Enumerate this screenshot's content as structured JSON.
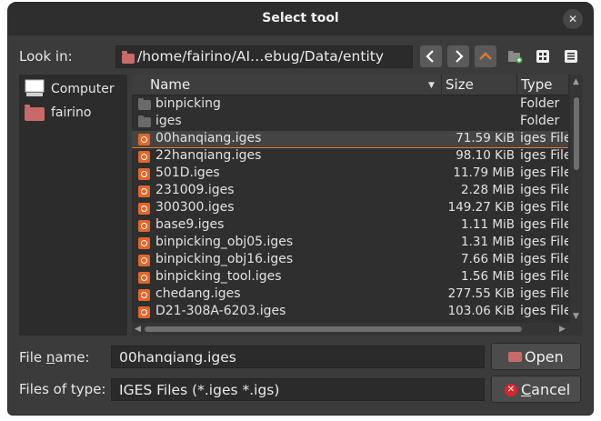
{
  "window": {
    "title": "Select tool"
  },
  "toolbar": {
    "look_in_label": "Look in:",
    "path": "/home/fairino/AI…ebug/Data/entity",
    "buttons": [
      "back-icon",
      "forward-icon",
      "up-icon",
      "new-folder-icon",
      "list-view-icon",
      "detail-view-icon"
    ],
    "accent": "#e0782e"
  },
  "sidebar": {
    "items": [
      {
        "label": "Computer",
        "icon": "computer-icon"
      },
      {
        "label": "fairino",
        "icon": "folder-icon"
      }
    ]
  },
  "filelist": {
    "columns": {
      "name": "Name",
      "size": "Size",
      "type": "Type"
    },
    "rows": [
      {
        "name": "binpicking",
        "size": "",
        "type": "Folder",
        "kind": "folder"
      },
      {
        "name": "iges",
        "size": "",
        "type": "Folder",
        "kind": "folder"
      },
      {
        "name": "00hanqiang.iges",
        "size": "71.59 KiB",
        "type": "iges File",
        "kind": "file"
      },
      {
        "name": "22hanqiang.iges",
        "size": "98.10 KiB",
        "type": "iges File",
        "kind": "file"
      },
      {
        "name": "501D.iges",
        "size": "11.79 MiB",
        "type": "iges File",
        "kind": "file"
      },
      {
        "name": "231009.iges",
        "size": "2.28 MiB",
        "type": "iges File",
        "kind": "file"
      },
      {
        "name": "300300.iges",
        "size": "149.27 KiB",
        "type": "iges File",
        "kind": "file"
      },
      {
        "name": "base9.iges",
        "size": "1.11 MiB",
        "type": "iges File",
        "kind": "file"
      },
      {
        "name": "binpicking_obj05.iges",
        "size": "1.31 MiB",
        "type": "iges File",
        "kind": "file"
      },
      {
        "name": "binpicking_obj16.iges",
        "size": "7.66 MiB",
        "type": "iges File",
        "kind": "file"
      },
      {
        "name": "binpicking_tool.iges",
        "size": "1.56 MiB",
        "type": "iges File",
        "kind": "file"
      },
      {
        "name": "chedang.iges",
        "size": "277.55 KiB",
        "type": "iges File",
        "kind": "file"
      },
      {
        "name": "D21-308A-6203.iges",
        "size": "103.06 KiB",
        "type": "iges File",
        "kind": "file"
      }
    ],
    "selected_index": 2
  },
  "form": {
    "file_name_label_pre": "File ",
    "file_name_label_u": "n",
    "file_name_label_post": "ame:",
    "file_name_value": "00hanqiang.iges",
    "file_type_label": "Files of type:",
    "file_type_value": "IGES Files (*.iges *.igs)",
    "open_label": "Open",
    "cancel_label_u": "C",
    "cancel_label_rest": "ancel"
  }
}
